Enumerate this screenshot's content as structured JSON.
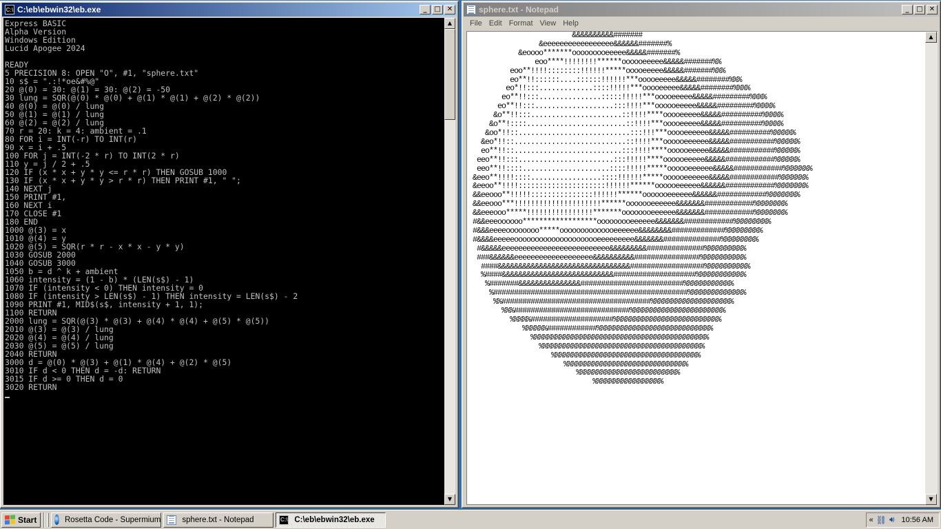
{
  "console": {
    "title": "C:\\eb\\ebwin32\\eb.exe",
    "icon": "C:\\",
    "lines": [
      "Express BASIC",
      "Alpha Version",
      "Windows Edition",
      "Lucid Apogee 2024",
      "",
      "READY",
      "5 PRECISION 8: OPEN \"O\", #1, \"sphere.txt\"",
      "10 s$ = \".:!*oe&#%@\"",
      "20 @(0) = 30: @(1) = 30: @(2) = -50",
      "30 lung = SQR(@(0) * @(0) + @(1) * @(1) + @(2) * @(2))",
      "40 @(0) = @(0) / lung",
      "50 @(1) = @(1) / lung",
      "60 @(2) = @(2) / lung",
      "70 r = 20: k = 4: ambient = .1",
      "80 FOR i = INT(-r) TO INT(r)",
      "90 x = i + .5",
      "100 FOR j = INT(-2 * r) TO INT(2 * r)",
      "110 y = j / 2 + .5",
      "120 IF (x * x + y * y <= r * r) THEN GOSUB 1000",
      "130 IF (x * x + y * y > r * r) THEN PRINT #1, \" \";",
      "140 NEXT j",
      "150 PRINT #1,",
      "160 NEXT i",
      "170 CLOSE #1",
      "180 END",
      "1000 @(3) = x",
      "1010 @(4) = y",
      "1020 @(5) = SQR(r * r - x * x - y * y)",
      "1030 GOSUB 2000",
      "1040 GOSUB 3000",
      "1050 b = d ^ k + ambient",
      "1060 intensity = (1 - b) * (LEN(s$) - 1)",
      "1070 IF (intensity < 0) THEN intensity = 0",
      "1080 IF (intensity > LEN(s$) - 1) THEN intensity = LEN(s$) - 2",
      "1090 PRINT #1, MID$(s$, intensity + 1, 1);",
      "1100 RETURN",
      "2000 lung = SQR(@(3) * @(3) + @(4) * @(4) + @(5) * @(5))",
      "2010 @(3) = @(3) / lung",
      "2020 @(4) = @(4) / lung",
      "2030 @(5) = @(5) / lung",
      "2040 RETURN",
      "3000 d = @(0) * @(3) + @(1) * @(4) + @(2) * @(5)",
      "3010 IF d < 0 THEN d = -d: RETURN",
      "3015 IF d >= 0 THEN d = 0",
      "3020 RETURN"
    ]
  },
  "notepad": {
    "title": "sphere.txt - Notepad",
    "menu": [
      "File",
      "Edit",
      "Format",
      "View",
      "Help"
    ],
    "text": "                         &&&&&&&&&&#######\n                 &eeeeeeeeeeeeeeeee&&&&&&#######%\n            &eoooo*******ooooooooeeeee&&&&&#######%\n                eoo****!!!!!!!!******oooooeeeee&&&&&#######%%\n          eoo**!!!!::::::::!!!!!!*****ooooeeeee&&&&&#######%%%\n          eo**!!::::::....::::::!!!!!!***ooooeeeee&&&&&########%%%\n         eo*!!:::.............::::!!!!!***ooooeeeee&&&&&########%%%%\n        eo**!!:::...............:::::!!!!!***ooooeeeee&&&&&#########%%%%\n       eo**!!:::...................:::!!!!***oooooeeeee&&&&&#########%%%%%\n      &o**!!:::......................::!!!!****ooooeeeee&&&&&##########%%%%%\n     &o**!::::........................::!!!!***ooooeeeee&&&&&##########%%%%%\n    &oo*!!::...........................:::!!!***ooooeeeeee&&&&&##########%%%%%%\n   &eo*!!::...........................::!!!!***oooooeeeeee&&&&&###########%%%%%%\n   eo**!!::..........................:::!!!!****oooooeeeee&&&&&###########%%%%%%\n  eeo**!!:::.......................:::!!!!!****oooooeeeee&&&&&############%%%%%%\n  eeo**!!::::.....................::::!!!!!*****oooooeeeeee&&&&&############%%%%%%%\n &eeo**!!!!::::.................::::!!!!!!*****oooooeeeeee&&&&&############%%%%%%%\n &eeoo**!!!!:::::::::::::::::::::!!!!!!******oooooeeeeee&&&&&&############%%%%%%%%\n &&eeooo**!!!!!:::::::::::::::!!!!!!******ooooooeeeeee&&&&&&############%%%%%%%%\n &&eeooo***!!!!!!!!!!!!!!!!!!!!!******ooooooeeeeee&&&&&&&############%%%%%%%%\n &&eeeooo*****!!!!!!!!!!!!!!!!*******oooooooeeeeee&&&&&&&############%%%%%%%%\n #&&eeeoooooo******************ooooooooeeeeee&&&&&&&############%%%%%%%%%\n #&&&eeeeoooooooo*****oooooooooooooeeeeee&&&&&&&&#############%%%%%%%%%\n #&&&&eeeeeooooooooooooooooooooeeeeeeeee&&&&&&&##############%%%%%%%%%\n  #&&&&&eeeeeeeeeeeeeeeeeeeeeeeeee&&&&&&&&&##############%%%%%%%%%%\n  ###&&&&&&eeeeeeeeeeeeeeeeeee&&&&&&&&&&################%%%%%%%%%%%\n   ####&&&&&&&&&&&&&&&&&&&&&&&&&&&&&&&&##################%%%%%%%%%%%\n   %####&&&&&&&&&&&&&&&&&&&&&&&&&&&####################%%%%%%%%%%%%\n    %#######&&&&&&&&&&&&&&&#########################%%%%%%%%%%%%\n     %###############################################%%%%%%%%%%%%%%\n      %%####################################%%%%%%%%%%%%%%%%%%%%\n        %%%############################%%%%%%%%%%%%%%%%%%%%%%%\n          %%%%%####################%%%%%%%%%%%%%%%%%%%%%%%%%%\n             %%%%%%############%%%%%%%%%%%%%%%%%%%%%%%%%%%%\n               %%%%%%%%%%%%%%%%%%%%%%%%%%%%%%%%%%%%%%%%%%%\n                 %%%%%%%%%%%%%%%%%%%%%%%%%%%%%%%%%%%%%%%%\n                    %%%%%%%%%%%%%%%%%%%%%%%%%%%%%%%%%%%%\n                       %%%%%%%%%%%%%%%%%%%%%%%%%%%%%%\n                          %%%%%%%%%%%%%%%%%%%%%%%%%\n                              %%%%%%%%%%%%%%%%%"
  },
  "taskbar": {
    "start_label": "Start",
    "tasks": [
      {
        "label": "Rosetta Code - Supermium",
        "icon": "browser-icon"
      },
      {
        "label": "sphere.txt - Notepad",
        "icon": "notepad-icon"
      },
      {
        "label": "C:\\eb\\ebwin32\\eb.exe",
        "icon": "console-icon"
      }
    ],
    "tray_expand": "«",
    "clock": "10:56 AM"
  },
  "colors": {
    "titlebar_active": "#0a246a",
    "titlebar_inactive": "#808080",
    "console_bg": "#000000",
    "console_fg": "#c0c0c0",
    "chrome": "#d4d0c8"
  }
}
